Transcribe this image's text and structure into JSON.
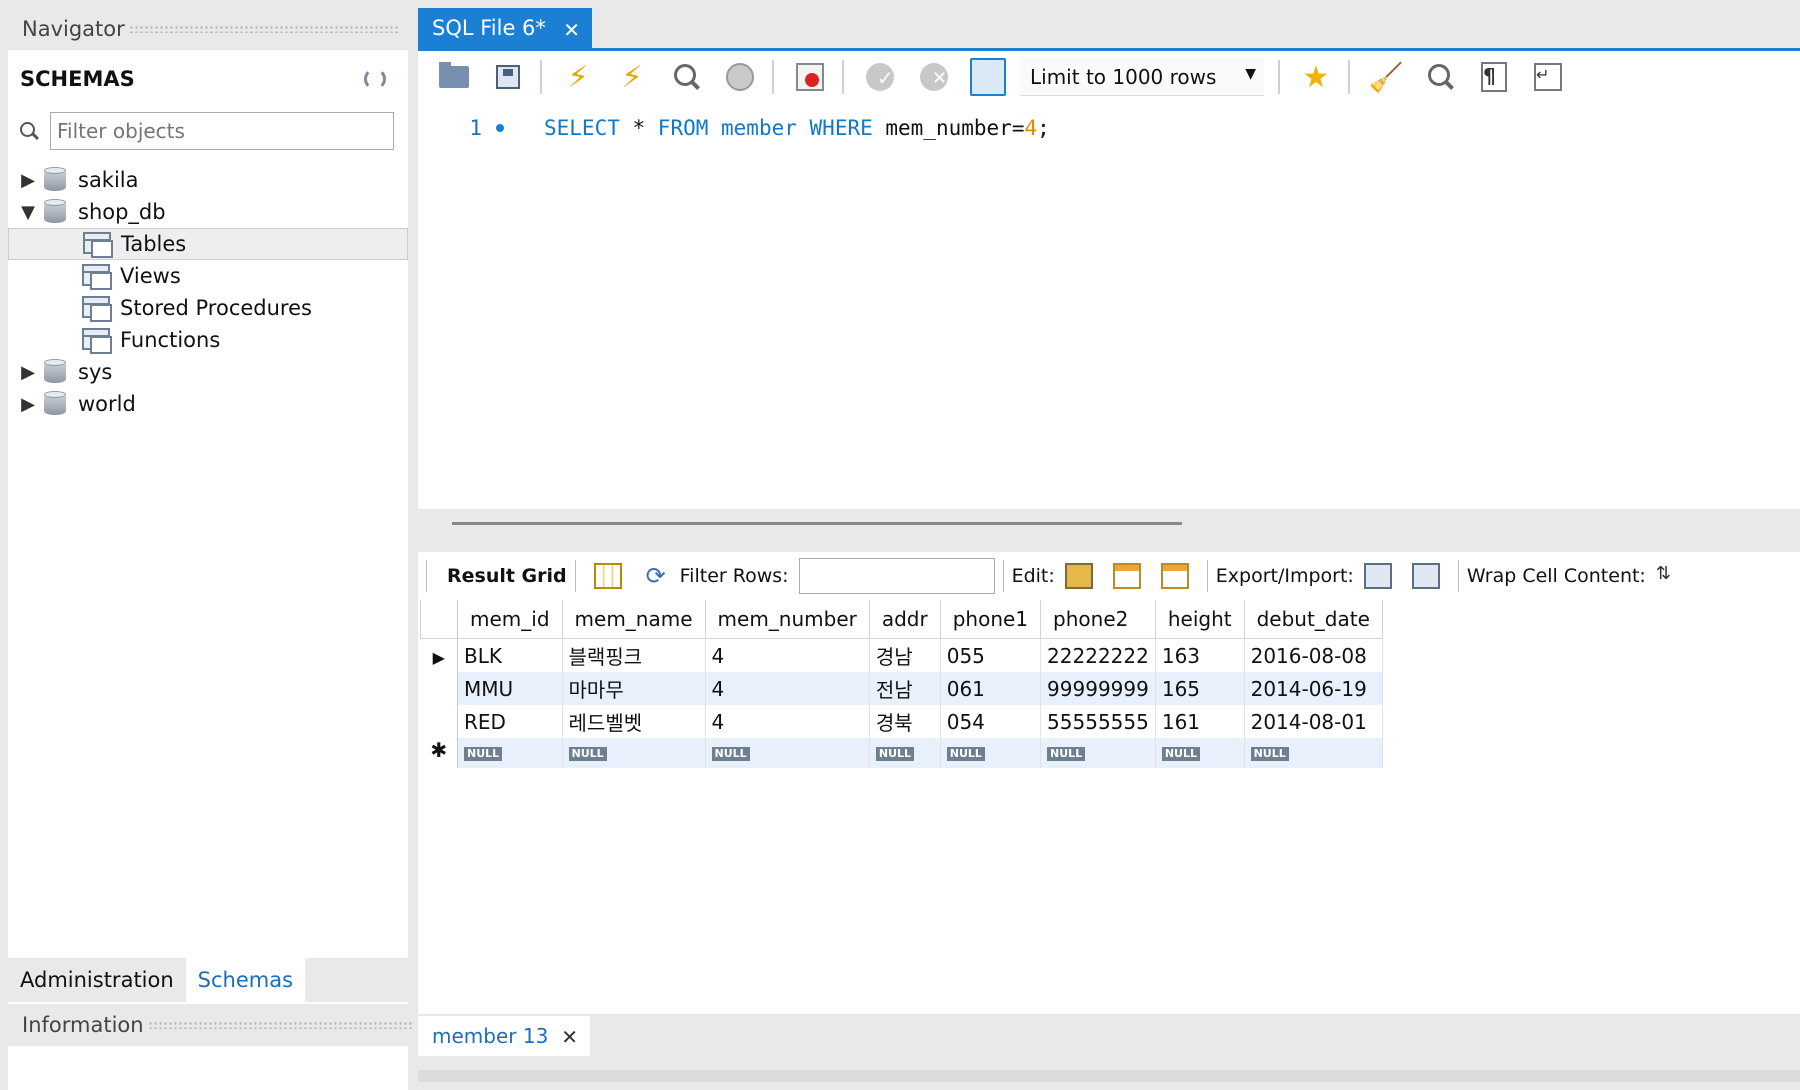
{
  "navigator": {
    "title": "Navigator",
    "schemas_label": "SCHEMAS",
    "filter_placeholder": "Filter objects",
    "tree": [
      {
        "label": "sakila",
        "expanded": false
      },
      {
        "label": "shop_db",
        "expanded": true
      },
      {
        "label": "world",
        "expanded": false
      }
    ],
    "shop_db_children": [
      "Tables",
      "Views",
      "Stored Procedures",
      "Functions"
    ],
    "sys_label": "sys",
    "bottom_tabs": [
      "Administration",
      "Schemas"
    ],
    "information_title": "Information"
  },
  "editor": {
    "tab_title": "SQL File 6*",
    "limit_label": "Limit to 1000 rows",
    "line_number": "1",
    "sql": {
      "kw1": "SELECT",
      "star": " * ",
      "kw2": "FROM",
      "table": " member ",
      "kw3": "WHERE",
      "cond": " mem_number=",
      "value": "4",
      "end": ";"
    }
  },
  "results": {
    "toolbar": {
      "result_grid": "Result Grid",
      "filter_rows": "Filter Rows:",
      "edit": "Edit:",
      "export_import": "Export/Import:",
      "wrap": "Wrap Cell Content:"
    },
    "columns": [
      "mem_id",
      "mem_name",
      "mem_number",
      "addr",
      "phone1",
      "phone2",
      "height",
      "debut_date"
    ],
    "rows": [
      [
        "BLK",
        "블랙핑크",
        "4",
        "경남",
        "055",
        "22222222",
        "163",
        "2016-08-08"
      ],
      [
        "MMU",
        "마마무",
        "4",
        "전남",
        "061",
        "99999999",
        "165",
        "2014-06-19"
      ],
      [
        "RED",
        "레드벨벳",
        "4",
        "경북",
        "054",
        "55555555",
        "161",
        "2014-08-01"
      ]
    ],
    "null_label": "NULL",
    "tab_label": "member 13"
  },
  "colors": {
    "accent": "#1b7fd4",
    "keyword": "#1278c8",
    "number": "#e08a00",
    "alt_row": "#e8f1fb"
  }
}
